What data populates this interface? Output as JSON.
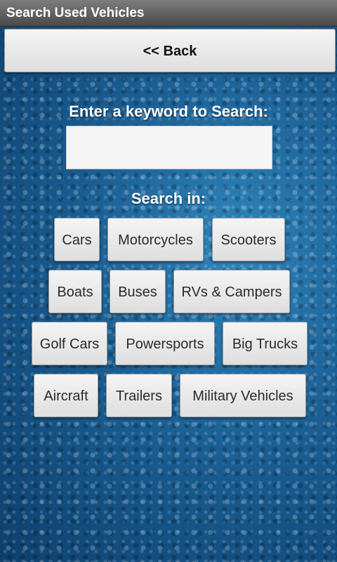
{
  "app": {
    "title": "Search Used Vehicles"
  },
  "nav": {
    "back_label": "<< Back"
  },
  "search": {
    "prompt": "Enter a keyword to Search:",
    "value": "",
    "placeholder": ""
  },
  "categories_label": "Search in:",
  "categories": [
    "Cars",
    "Motorcycles",
    "Scooters",
    "Boats",
    "Buses",
    "RVs & Campers",
    "Golf Cars",
    "Powersports",
    "Big Trucks",
    "Aircraft",
    "Trailers",
    "Military Vehicles"
  ],
  "colors": {
    "title_bar": "#5e5e5e",
    "background": "#1a5f94",
    "button": "#e8e8e8"
  }
}
